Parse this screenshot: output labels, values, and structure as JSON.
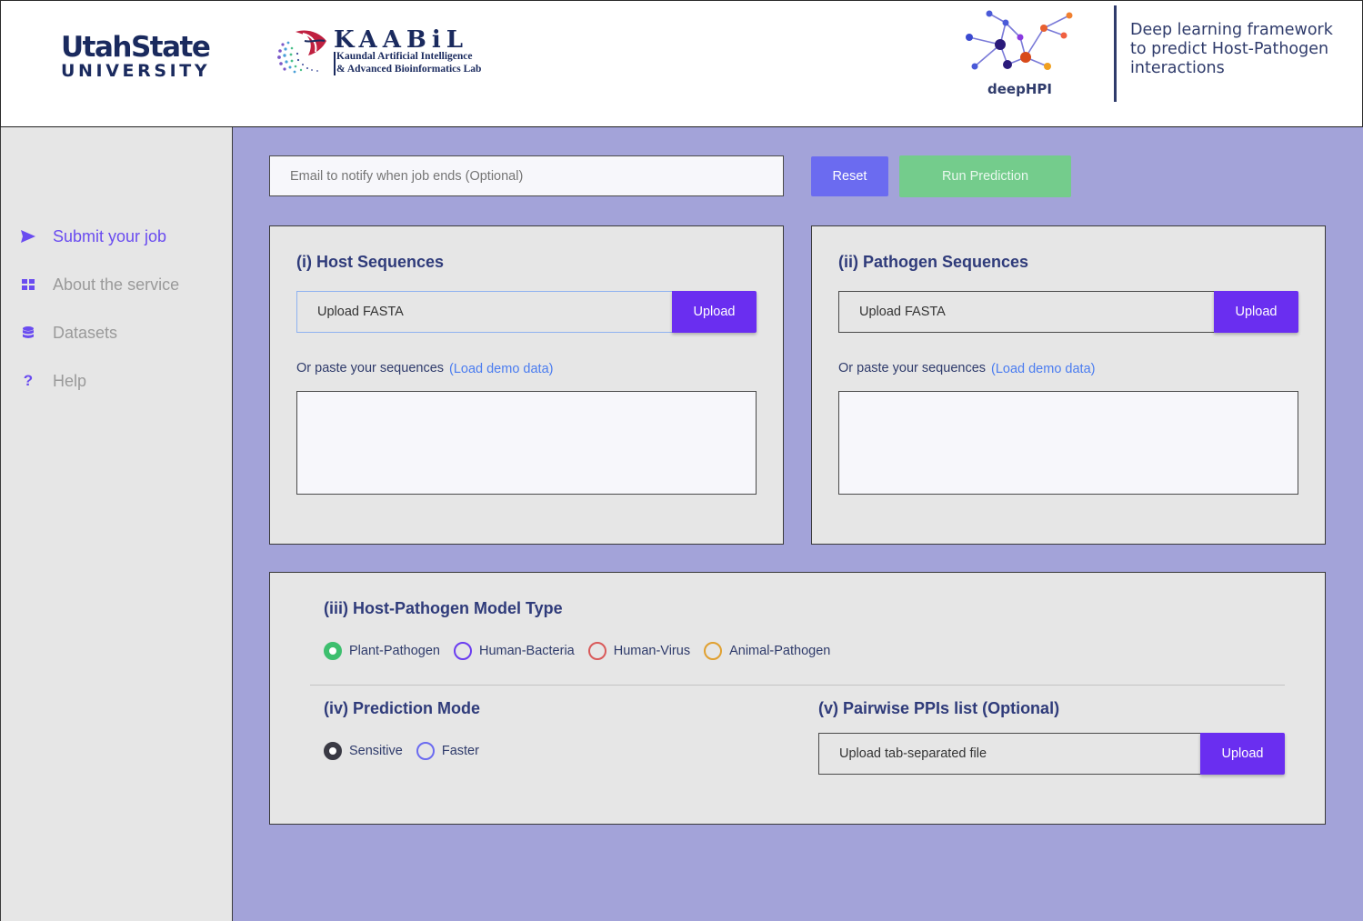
{
  "header": {
    "usu_line1": "UtahState",
    "usu_line2": "UNIVERSITY",
    "kaabil_title": "KAABiL",
    "kaabil_sub1": "Kaundal Artificial Intelligence",
    "kaabil_sub2": "& Advanced Bioinformatics Lab",
    "deephpi_label": "deepHPI",
    "tagline": [
      "Deep learning framework",
      "to predict Host-Pathogen",
      "interactions"
    ]
  },
  "sidebar": {
    "items": [
      {
        "label": "Submit your job",
        "icon": "send-icon",
        "active": true
      },
      {
        "label": "About the service",
        "icon": "dashboard-icon",
        "active": false
      },
      {
        "label": "Datasets",
        "icon": "database-icon",
        "active": false
      },
      {
        "label": "Help",
        "icon": "question-icon",
        "active": false
      }
    ]
  },
  "toolbar": {
    "email_placeholder": "Email to notify when job ends (Optional)",
    "reset_label": "Reset",
    "run_label": "Run Prediction"
  },
  "host": {
    "title": "(i) Host Sequences",
    "upload_placeholder": "Upload FASTA",
    "upload_label": "Upload",
    "paste_label": "Or paste your sequences",
    "demo_label": "(Load demo data)"
  },
  "pathogen": {
    "title": "(ii) Pathogen Sequences",
    "upload_placeholder": "Upload FASTA",
    "upload_label": "Upload",
    "paste_label": "Or paste your sequences",
    "demo_label": "(Load demo data)"
  },
  "model": {
    "title": "(iii) Host-Pathogen Model Type",
    "options": [
      {
        "label": "Plant-Pathogen",
        "color": "#3dbf6e",
        "checked": true
      },
      {
        "label": "Human-Bacteria",
        "color": "#6a3cf0",
        "checked": false
      },
      {
        "label": "Human-Virus",
        "color": "#d95a5a",
        "checked": false
      },
      {
        "label": "Animal-Pathogen",
        "color": "#e0a030",
        "checked": false
      }
    ]
  },
  "mode": {
    "title": "(iv) Prediction Mode",
    "options": [
      {
        "label": "Sensitive",
        "color": "#3a3a44",
        "checked": true
      },
      {
        "label": "Faster",
        "color": "#6b6bf0",
        "checked": false
      }
    ]
  },
  "ppis": {
    "title": "(v) Pairwise PPIs list (Optional)",
    "upload_placeholder": "Upload tab-separated file",
    "upload_label": "Upload"
  }
}
